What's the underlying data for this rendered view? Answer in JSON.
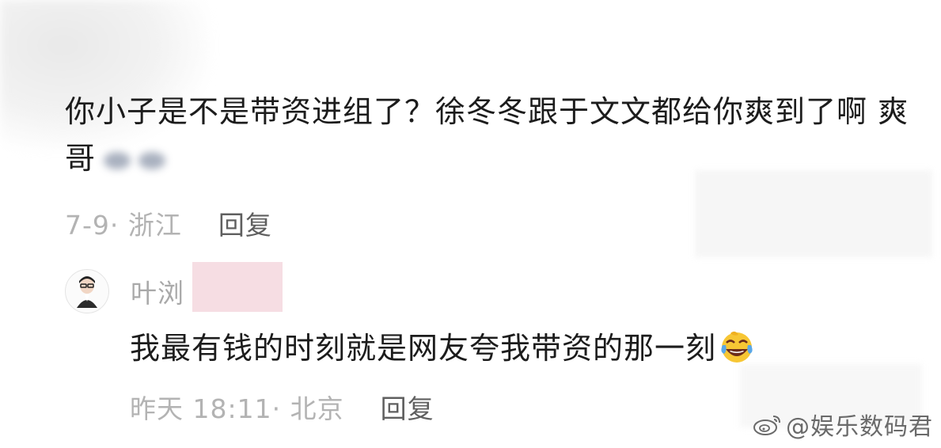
{
  "comment": {
    "text": "你小子是不是带资进组了？徐冬冬跟于文文都给你爽到了啊 爽哥",
    "meta": "7-9· 浙江",
    "reply_label": "回复"
  },
  "reply": {
    "username": "叶浏",
    "text": "我最有钱的时刻就是网友夸我带资的那一刻",
    "meta": "昨天 18:11· 北京",
    "reply_label": "回复"
  },
  "watermark": {
    "text": "@娱乐数码君",
    "icon": "weibo-icon"
  },
  "icons": {
    "reply_emoji": "laughing-crying-emoji-icon",
    "blurred_emoji": "blurred-emoji-icon"
  }
}
